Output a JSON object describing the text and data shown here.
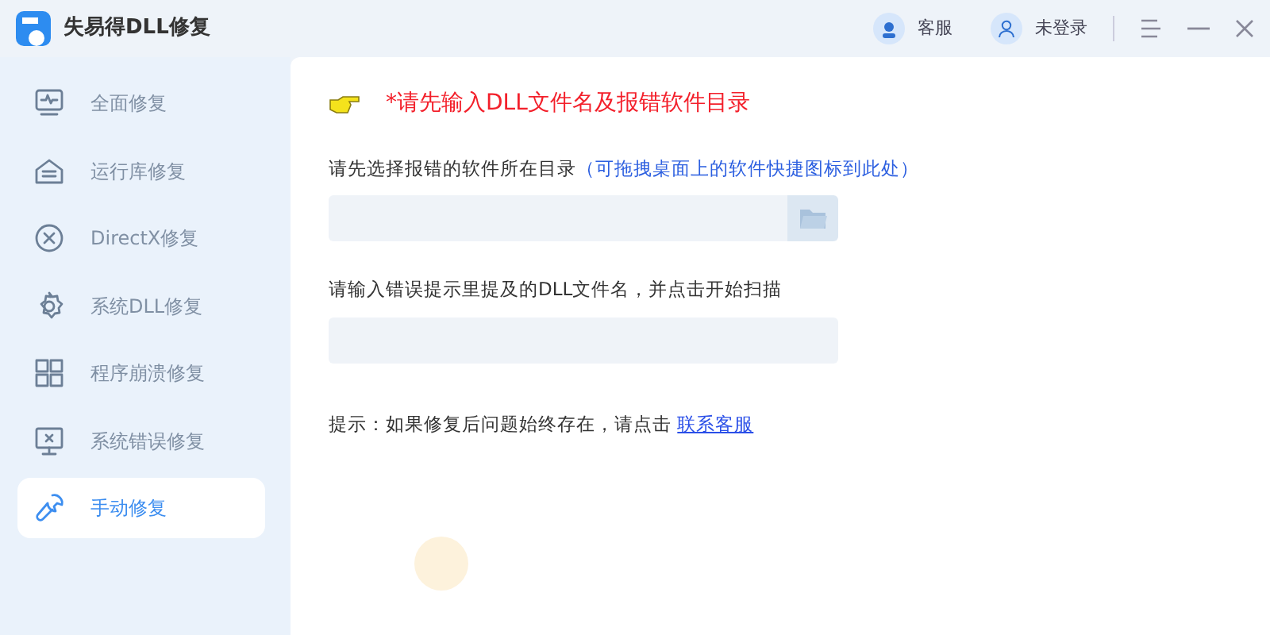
{
  "window": {
    "title": "失易得DLL修复",
    "service": "客服",
    "login": "未登录"
  },
  "sidebar": {
    "items": [
      {
        "label": "全面修复",
        "selected": false
      },
      {
        "label": "运行库修复",
        "selected": false
      },
      {
        "label": "DirectX修复",
        "selected": false
      },
      {
        "label": "系统DLL修复",
        "selected": false
      },
      {
        "label": "程序崩溃修复",
        "selected": false
      },
      {
        "label": "系统错误修复",
        "selected": false
      },
      {
        "label": "手动修复",
        "selected": true
      }
    ]
  },
  "main": {
    "heading": "*请先输入DLL文件名及报错软件目录",
    "directory": {
      "label": "请先选择报错的软件所在目录",
      "hint": "（可拖拽桌面上的软件快捷图标到此处）"
    },
    "filename": {
      "label": "请输入错误提示里提及的DLL文件名，并点击开始扫描"
    },
    "tip": {
      "text": "提示：如果修复后问题始终存在，请点击",
      "link": "联系客服"
    }
  }
}
